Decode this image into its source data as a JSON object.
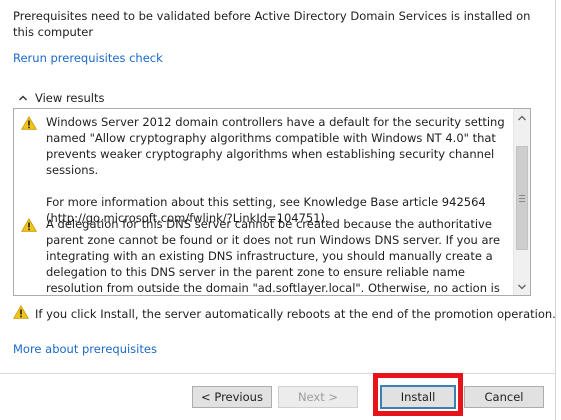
{
  "heading": "Prerequisites need to be validated before Active Directory Domain Services is installed on this computer",
  "rerun_link": "Rerun prerequisites check",
  "view_results": {
    "label": "View results",
    "icon": "chevron-up-icon",
    "entries": [
      {
        "icon": "warning-icon",
        "paragraphs": [
          "Windows Server 2012 domain controllers have a default for the security setting named \"Allow cryptography algorithms compatible with Windows NT 4.0\" that prevents weaker cryptography algorithms when establishing security channel sessions.",
          "For more information about this setting, see Knowledge Base article 942564 (http://go.microsoft.com/fwlink/?LinkId=104751)."
        ]
      },
      {
        "icon": "warning-icon",
        "paragraphs": [
          "A delegation for this DNS server cannot be created because the authoritative parent zone cannot be found or it does not run Windows DNS server. If you are integrating with an existing DNS infrastructure, you should manually create a delegation to this DNS server in the parent zone to ensure reliable name resolution from outside the domain \"ad.softlayer.local\". Otherwise, no action is required."
        ]
      }
    ]
  },
  "reboot_notice": "If you click Install, the server automatically reboots at the end of the promotion operation.",
  "more_link": "More about prerequisites",
  "buttons": {
    "previous": "< Previous",
    "next": "Next >",
    "install": "Install",
    "cancel": "Cancel"
  },
  "colors": {
    "link": "#1b6ac9",
    "warning": "#f0c419",
    "highlight": "#e8141c"
  }
}
